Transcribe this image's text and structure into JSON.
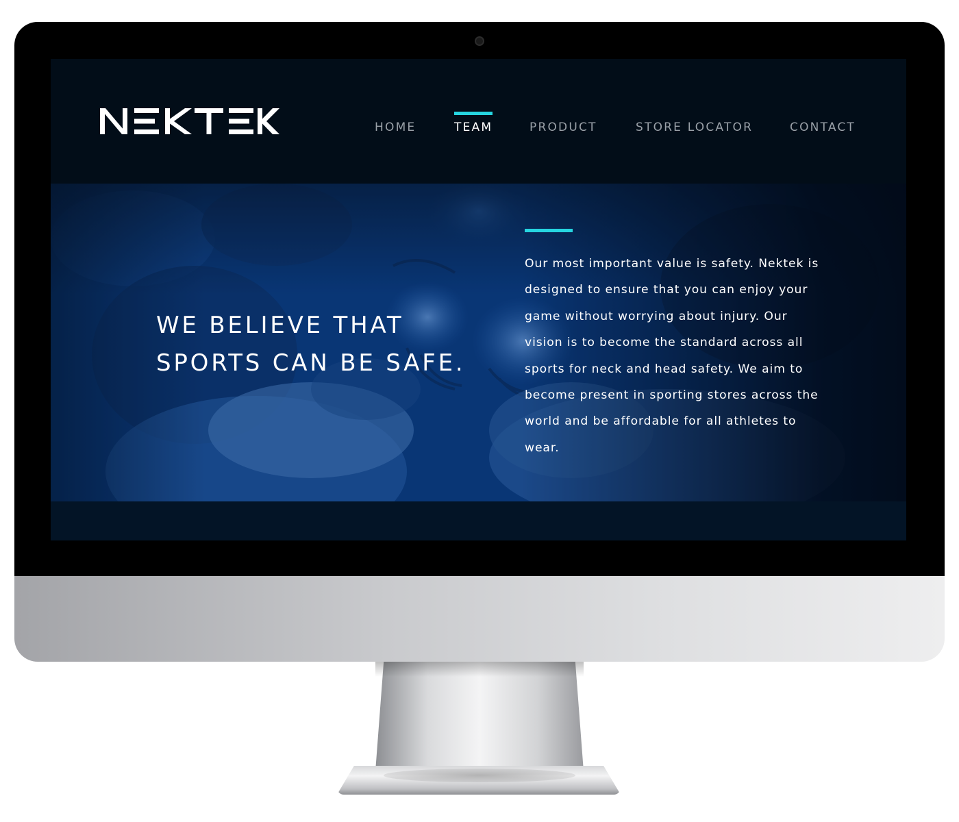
{
  "brand": {
    "name": "NEKTEK"
  },
  "nav": {
    "items": [
      {
        "label": "HOME",
        "active": false
      },
      {
        "label": "TEAM",
        "active": true
      },
      {
        "label": "PRODUCT",
        "active": false
      },
      {
        "label": "STORE LOCATOR",
        "active": false
      },
      {
        "label": "CONTACT",
        "active": false
      }
    ]
  },
  "hero": {
    "heading_line1": "WE BELIEVE THAT",
    "heading_line2": "SPORTS CAN BE SAFE.",
    "body": "Our most important value is safety. Nektek is designed to ensure that you can enjoy your game without worrying about injury. Our vision is to become the standard across all sports for neck and head safety. We aim to become present in sporting stores across the world and be affordable for all athletes to wear."
  },
  "colors": {
    "accent": "#26d5e0",
    "header_bg": "#020d18",
    "hero_tint": "#0a3f8a",
    "text": "#ffffff",
    "nav_text": "#9aa1a8"
  },
  "icons": {
    "logo": "nektek-wordmark-logo",
    "camera": "webcam-dot"
  }
}
